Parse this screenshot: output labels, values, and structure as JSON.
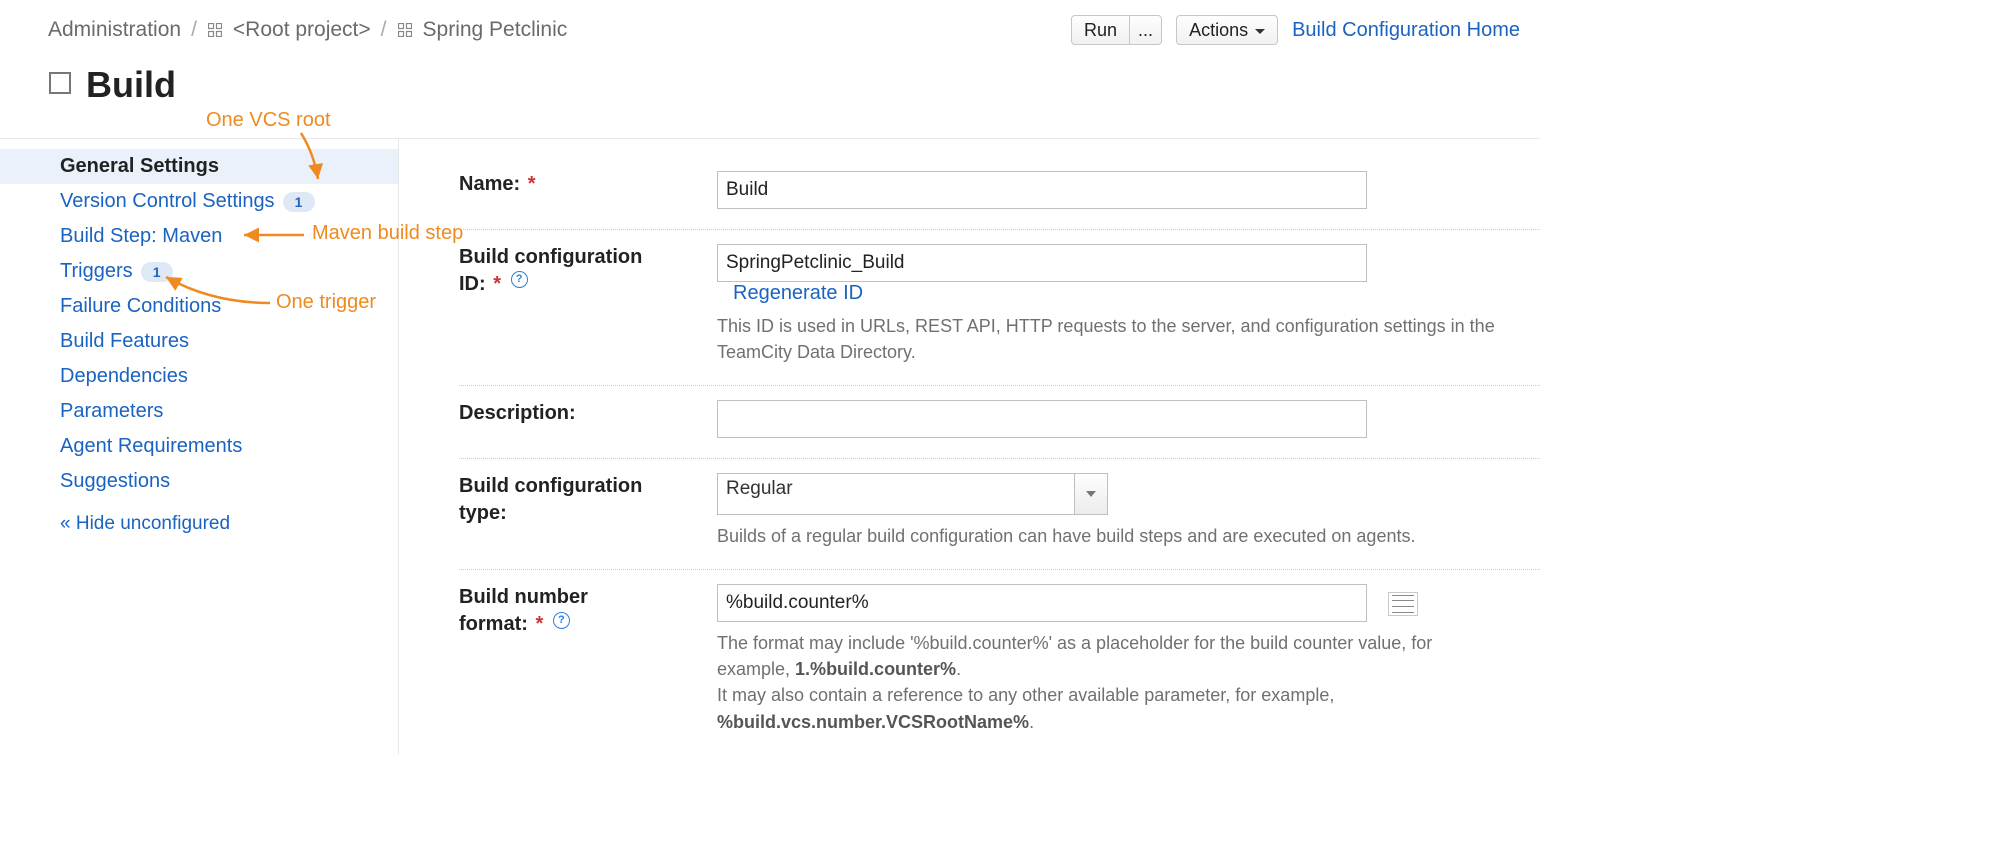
{
  "breadcrumbs": {
    "admin": "Administration",
    "root": "<Root project>",
    "project": "Spring Petclinic"
  },
  "header_buttons": {
    "run": "Run",
    "run_more": "...",
    "actions": "Actions",
    "home_link": "Build Configuration Home"
  },
  "page_title": "Build",
  "sidebar": {
    "items": [
      {
        "label": "General Settings",
        "badge": "",
        "active": true
      },
      {
        "label": "Version Control Settings",
        "badge": "1"
      },
      {
        "label": "Build Step: Maven",
        "badge": ""
      },
      {
        "label": "Triggers",
        "badge": "1"
      },
      {
        "label": "Failure Conditions",
        "badge": ""
      },
      {
        "label": "Build Features",
        "badge": ""
      },
      {
        "label": "Dependencies",
        "badge": ""
      },
      {
        "label": "Parameters",
        "badge": ""
      },
      {
        "label": "Agent Requirements",
        "badge": ""
      },
      {
        "label": "Suggestions",
        "badge": ""
      }
    ],
    "hide": "« Hide unconfigured"
  },
  "annotations": {
    "a1": "One VCS root",
    "a2": "Maven build step",
    "a3": "One trigger"
  },
  "form": {
    "name": {
      "label": "Name:",
      "value": "Build"
    },
    "id": {
      "label_l1": "Build configuration",
      "label_l2": "ID:",
      "value": "SpringPetclinic_Build",
      "regen": "Regenerate ID",
      "help": "This ID is used in URLs, REST API, HTTP requests to the server, and configuration settings in the TeamCity Data Directory."
    },
    "desc": {
      "label": "Description:",
      "value": ""
    },
    "type": {
      "label_l1": "Build configuration",
      "label_l2": "type:",
      "value": "Regular",
      "help": "Builds of a regular build configuration can have build steps and are executed on agents."
    },
    "number": {
      "label_l1": "Build number",
      "label_l2": "format:",
      "value": "%build.counter%",
      "help_plain1": "The format may include '%build.counter%' as a placeholder for the build counter value, for example, ",
      "help_bold1": "1.%build.counter%",
      "help_plain2a": ".",
      "help_plain2": "It may also contain a reference to any other available parameter, for example, ",
      "help_bold2": "%build.vcs.number.VCSRootName%",
      "help_plain3": "."
    }
  }
}
